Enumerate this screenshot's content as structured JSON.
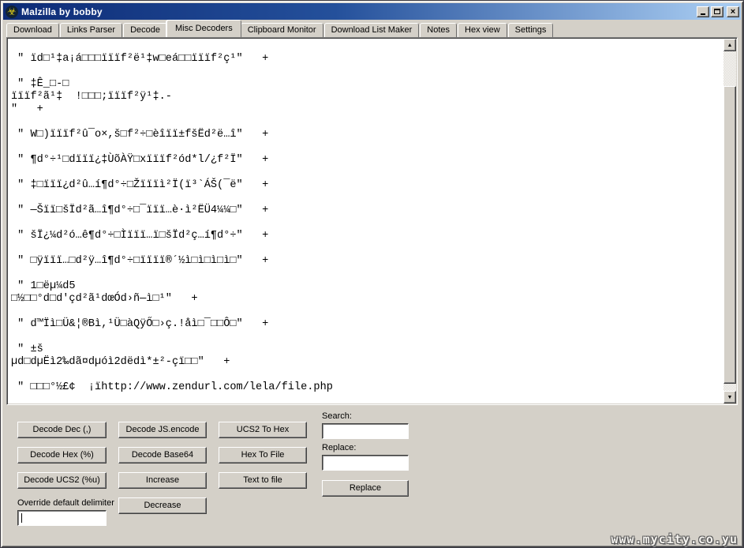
{
  "window": {
    "title": "Malzilla by bobby",
    "icon_glyph": "☣",
    "controls": {
      "close": "×"
    }
  },
  "tabs": [
    {
      "label": "Download",
      "active": false
    },
    {
      "label": "Links Parser",
      "active": false
    },
    {
      "label": "Decode",
      "active": false
    },
    {
      "label": "Misc Decoders",
      "active": true
    },
    {
      "label": "Clipboard Monitor",
      "active": false
    },
    {
      "label": "Download List Maker",
      "active": false
    },
    {
      "label": "Notes",
      "active": false
    },
    {
      "label": "Hex view",
      "active": false
    },
    {
      "label": "Settings",
      "active": false
    }
  ],
  "editor": {
    "lines": [
      "",
      " \" ïd□¹‡a¡á□□□ïïïf²ë¹‡w□eá□□ïïïf²ç¹\"   +",
      "",
      " \" ‡Ê_□-□",
      "ïïïf²ã¹‡  !□□□;ïïïf²ÿ¹‡.-",
      "\"   +",
      "",
      " \" W□)ïïïf²û¯o×,š□f²÷□èîïï±fšËd²ë…î\"   +",
      "",
      " \" ¶d°÷¹□dïïï¿‡ÙõÀŸ□xïïïf²ód*l/¿f²Ï\"   +",
      "",
      " \" ‡□ïïï¿d²û…í¶d°÷□Žïïïì²Ï(ï³`ÁŠ(¯ë\"   +",
      "",
      " \" —Šïï□šÏd²ã…î¶d°÷□¯ïïï…è·ì²ËÜ4¼¼□\"   +",
      "",
      " \" šÏ¿¼d²ó…ê¶d°÷□Ìïïï…ï□šÏd²ç…í¶d°÷\"   +",
      "",
      " \" □ÿïïï…□d²ÿ…î¶d°÷□ïïïï®´½ì□ì□ì□ì□\"   +",
      "",
      " \" 1□ëµ¼d5",
      "□½□□°d□d'çd²ã¹dœÓd›ñ—ì□¹\"   +",
      "",
      " \" d™Ïì□Ü&¦®Bì,¹Ü□àQÿŐ□›ç.!åì□¯□□Ô□\"   +",
      "",
      " \" ±š",
      "µd□dµËì2‰dã¤dµóì2dëdì*±²-çï□□\"   +",
      "",
      " \" □□□°½£¢  ¡ïhttp://www.zendurl.com/lela/file.php"
    ],
    "scrollbar": {
      "up_glyph": "▲",
      "down_glyph": "▼"
    }
  },
  "decoder_panel": {
    "buttons": [
      {
        "id": "decode-dec",
        "label": "Decode Dec (,)"
      },
      {
        "id": "decode-js-encode",
        "label": "Decode JS.encode"
      },
      {
        "id": "ucs2-to-hex",
        "label": "UCS2 To Hex"
      },
      {
        "id": "decode-hex",
        "label": "Decode Hex (%)"
      },
      {
        "id": "decode-base64",
        "label": "Decode Base64"
      },
      {
        "id": "hex-to-file",
        "label": "Hex To File"
      },
      {
        "id": "decode-ucs2",
        "label": "Decode UCS2 (%u)"
      },
      {
        "id": "increase",
        "label": "Increase"
      },
      {
        "id": "text-to-file",
        "label": "Text to file"
      }
    ],
    "decrease_button": "Decrease",
    "override_label": "Override default delimiter",
    "override_value": "",
    "search_label": "Search:",
    "search_value": "",
    "replace_label": "Replace:",
    "replace_value": "",
    "replace_button": "Replace"
  },
  "watermark": "www.mycity.co.yu"
}
